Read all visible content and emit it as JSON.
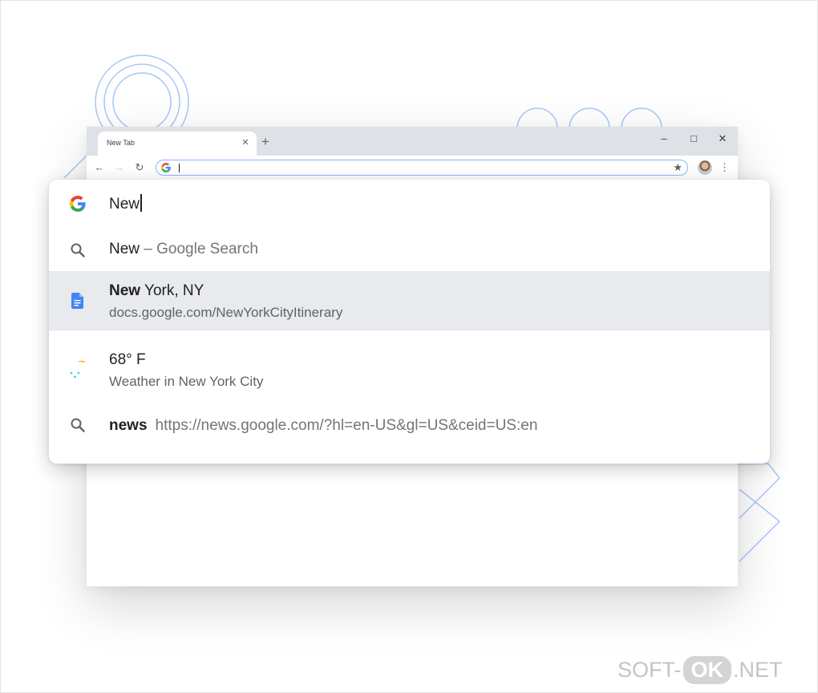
{
  "colors": {
    "accent_blue": "#4285f4",
    "google_red": "#ea4335",
    "google_yellow": "#fbbc05",
    "google_green": "#34a853",
    "weather_sun": "#fbbc04",
    "weather_rain": "#4ecde6",
    "selected_row": "#e8eaed",
    "deco_lines": "#8ab4f8"
  },
  "browser": {
    "tab": {
      "title": "New Tab",
      "close_icon": "close-icon"
    },
    "new_tab_icon": "plus-icon",
    "window_controls": {
      "minimize": "–",
      "maximize": "□",
      "close": "✕"
    },
    "toolbar": {
      "back_icon": "arrow-left-icon",
      "forward_icon": "arrow-right-icon",
      "reload_icon": "reload-icon",
      "address_value": "",
      "bookmark_icon": "star-icon",
      "menu_icon": "kebab-menu-icon"
    }
  },
  "omnibox": {
    "input_value": "New",
    "suggestions": [
      {
        "type": "search",
        "icon": "search-icon",
        "bold": "New",
        "rest": " – Google Search"
      },
      {
        "type": "document",
        "icon": "google-docs-icon",
        "title_bold": "New",
        "title_rest": " York, NY",
        "url": "docs.google.com/NewYorkCityItinerary",
        "selected": true
      },
      {
        "type": "weather",
        "icon": "weather-icon",
        "title": "68° F",
        "subtitle": "Weather in New York City"
      },
      {
        "type": "navsuggest",
        "icon": "search-icon",
        "bold": "news",
        "url": "https://news.google.com/?hl=en-US&gl=US&ceid=US:en"
      }
    ]
  },
  "watermark": {
    "left": "SOFT-",
    "pill": "OK",
    "right": ".NET"
  }
}
